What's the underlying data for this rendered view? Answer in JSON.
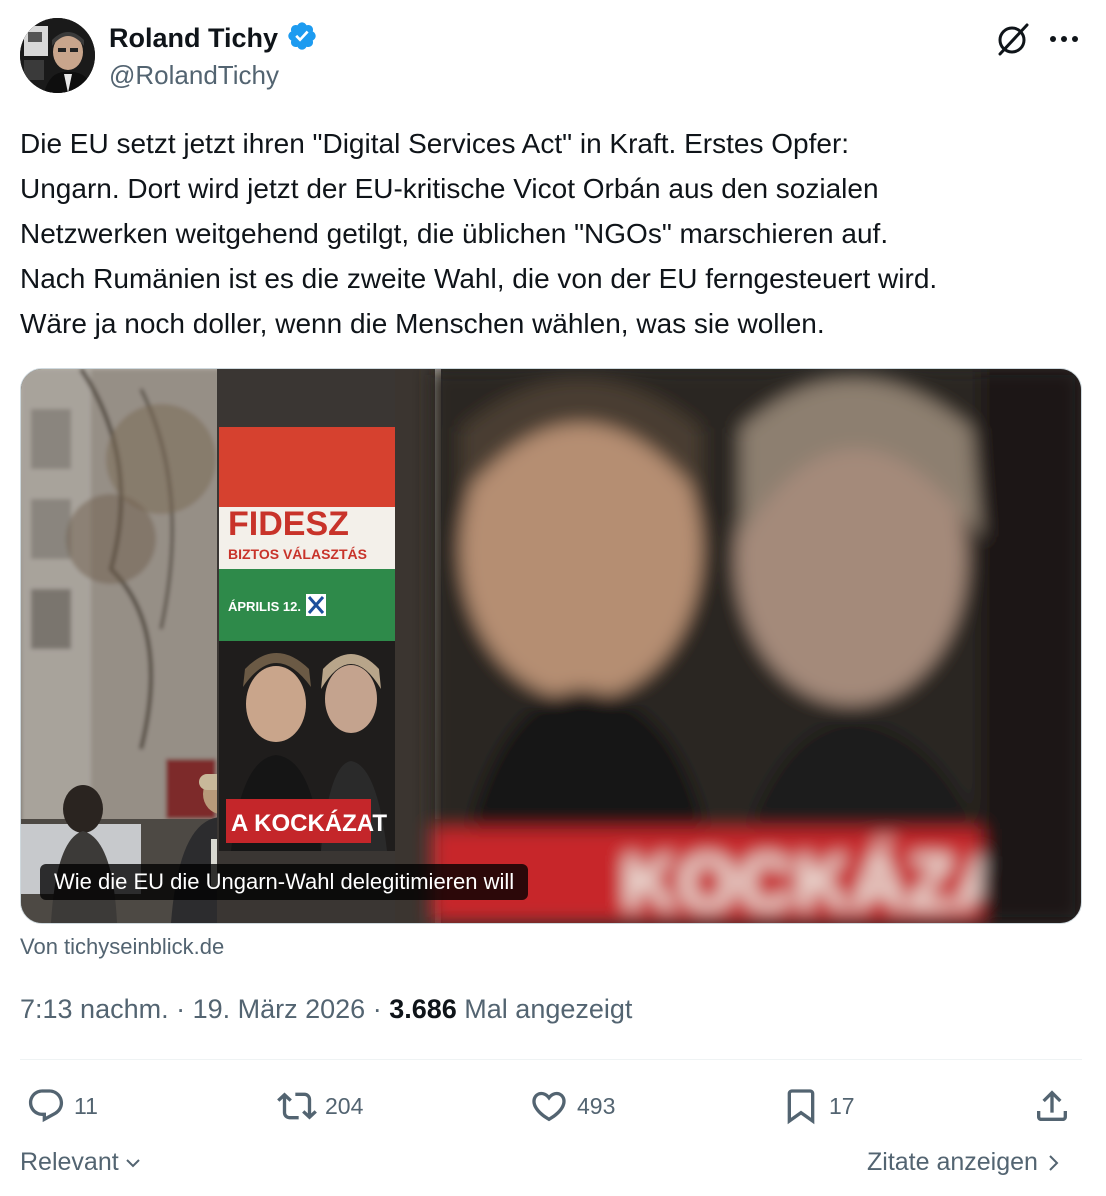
{
  "author": {
    "name": "Roland Tichy",
    "handle": "@RolandTichy",
    "verified_color": "#1d9bf0"
  },
  "tweet": {
    "text": "Die EU setzt jetzt ihren \"Digital Services Act\" in Kraft. Erstes Opfer:\nUngarn. Dort wird jetzt der EU-kritische Vicot Orbán aus den sozialen\nNetzwerken weitgehend getilgt, die üblichen \"NGOs\" marschieren auf.\nNach Rumänien ist es die zweite Wahl, die von der EU ferngesteuert wird.\nWäre ja noch doller, wenn die Menschen wählen, was sie wollen."
  },
  "card": {
    "caption": "Wie die EU die Ungarn-Wahl delegitimieren will",
    "source": "Von tichyseinblick.de",
    "poster": {
      "party": "FIDESZ",
      "slogan": "BIZTOS VÁLASZTÁS",
      "date": "ÁPRILIS 12.",
      "banner": "A KOCKÁZAT",
      "big_banner": "KOCKÁZAT"
    }
  },
  "meta": {
    "time": "7:13 nachm.",
    "date": "19. März 2026",
    "views_count": "3.686",
    "views_label": "Mal angezeigt"
  },
  "actions": {
    "replies": "11",
    "reposts": "204",
    "likes": "493",
    "bookmarks": "17"
  },
  "footer": {
    "sort_label": "Relevant",
    "quotes_label": "Zitate anzeigen"
  },
  "colors": {
    "text": "#0f1419",
    "muted": "#536471",
    "accent": "#1d9bf0",
    "divider": "#eff3f4"
  }
}
